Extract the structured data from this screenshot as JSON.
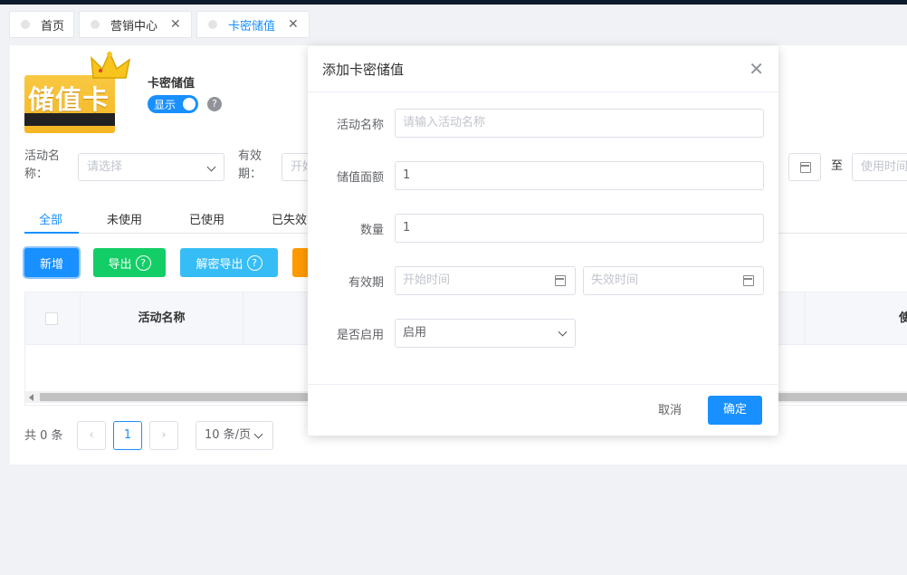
{
  "tabs": [
    {
      "label": "首页",
      "closable": false
    },
    {
      "label": "营销中心",
      "closable": true
    },
    {
      "label": "卡密储值",
      "closable": true,
      "active": true
    }
  ],
  "page": {
    "card_image_text": "储值卡",
    "title": "卡密储值",
    "switch_label": "显示",
    "help": "?"
  },
  "filters": {
    "activity_label": "活动名称：",
    "activity_placeholder": "请选择",
    "validity_label": "有效期：",
    "validity_start_placeholder": "开始",
    "range_sep": "至",
    "use_time_placeholder": "使用时间"
  },
  "subtabs": [
    "全部",
    "未使用",
    "已使用",
    "已失效"
  ],
  "toolbar": {
    "add": "新增",
    "export": "导出",
    "decrypt_export": "解密导出",
    "help": "?"
  },
  "table": {
    "columns": [
      "活动名称",
      "使用"
    ]
  },
  "pagination": {
    "total": "共 0 条",
    "prev": "‹",
    "current": "1",
    "next": "›",
    "page_size": "10 条/页"
  },
  "dialog": {
    "title": "添加卡密储值",
    "close": "✕",
    "fields": {
      "activity_name": {
        "label": "活动名称",
        "placeholder": "请输入活动名称"
      },
      "face_value": {
        "label": "储值面额",
        "value": "1"
      },
      "quantity": {
        "label": "数量",
        "value": "1"
      },
      "validity": {
        "label": "有效期",
        "start_placeholder": "开始时间",
        "end_placeholder": "失效时间"
      },
      "enabled": {
        "label": "是否启用",
        "value": "启用"
      }
    },
    "cancel": "取消",
    "confirm": "确定"
  },
  "colors": {
    "primary": "#1890ff",
    "add_btn": "#1890ff",
    "export_btn": "#13ce66",
    "decrypt_btn": "#36bdf5",
    "orange_btn": "#ff9900"
  }
}
